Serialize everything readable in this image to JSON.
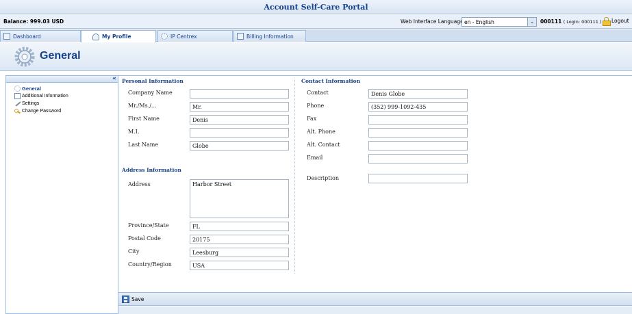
{
  "window": {
    "title": "Account Self-Care Portal"
  },
  "infobar": {
    "balance": "Balance: 999.03 USD",
    "language_label": "Web Interface Language:",
    "language_value": "en - English",
    "account_id": "000111",
    "login_text": "( Login: 000111 )",
    "logout_label": "Logout"
  },
  "tabs": [
    {
      "label": "Dashboard",
      "icon": "dashboard-icon"
    },
    {
      "label": "My Profile",
      "icon": "user-icon"
    },
    {
      "label": "IP Centrex",
      "icon": "gear-icon"
    },
    {
      "label": "Billing Information",
      "icon": "document-icon"
    }
  ],
  "header": {
    "title": "General"
  },
  "sidebar": {
    "collapse_label": "«",
    "items": [
      {
        "label": "General",
        "icon": "gear-icon",
        "selected": true
      },
      {
        "label": "Additional Information",
        "icon": "document-icon"
      },
      {
        "label": "Settings",
        "icon": "wrench-icon"
      },
      {
        "label": "Change Password",
        "icon": "key-icon"
      }
    ]
  },
  "personal": {
    "title": "Personal Information",
    "company_label": "Company Name",
    "company_value": "",
    "salutation_label": "Mr./Ms./...",
    "salutation_value": "Mr.",
    "first_label": "First Name",
    "first_value": "Denis",
    "mi_label": "M.I.",
    "mi_value": "",
    "last_label": "Last Name",
    "last_value": "Globe"
  },
  "address": {
    "title": "Address Information",
    "address_label": "Address",
    "address_value": "Harbor Street",
    "province_label": "Province/State",
    "province_value": "FL",
    "postal_label": "Postal Code",
    "postal_value": "20175",
    "city_label": "City",
    "city_value": "Leesburg",
    "country_label": "Country/Region",
    "country_value": "USA"
  },
  "contact": {
    "title": "Contact Information",
    "contact_label": "Contact",
    "contact_value": "Denis Globe",
    "phone_label": "Phone",
    "phone_value": "(352) 999-1092-435",
    "fax_label": "Fax",
    "fax_value": "",
    "alt_phone_label": "Alt. Phone",
    "alt_phone_value": "",
    "alt_contact_label": "Alt. Contact",
    "alt_contact_value": "",
    "email_label": "Email",
    "email_value": "",
    "description_label": "Description",
    "description_value": ""
  },
  "toolbar": {
    "save_label": "Save"
  }
}
